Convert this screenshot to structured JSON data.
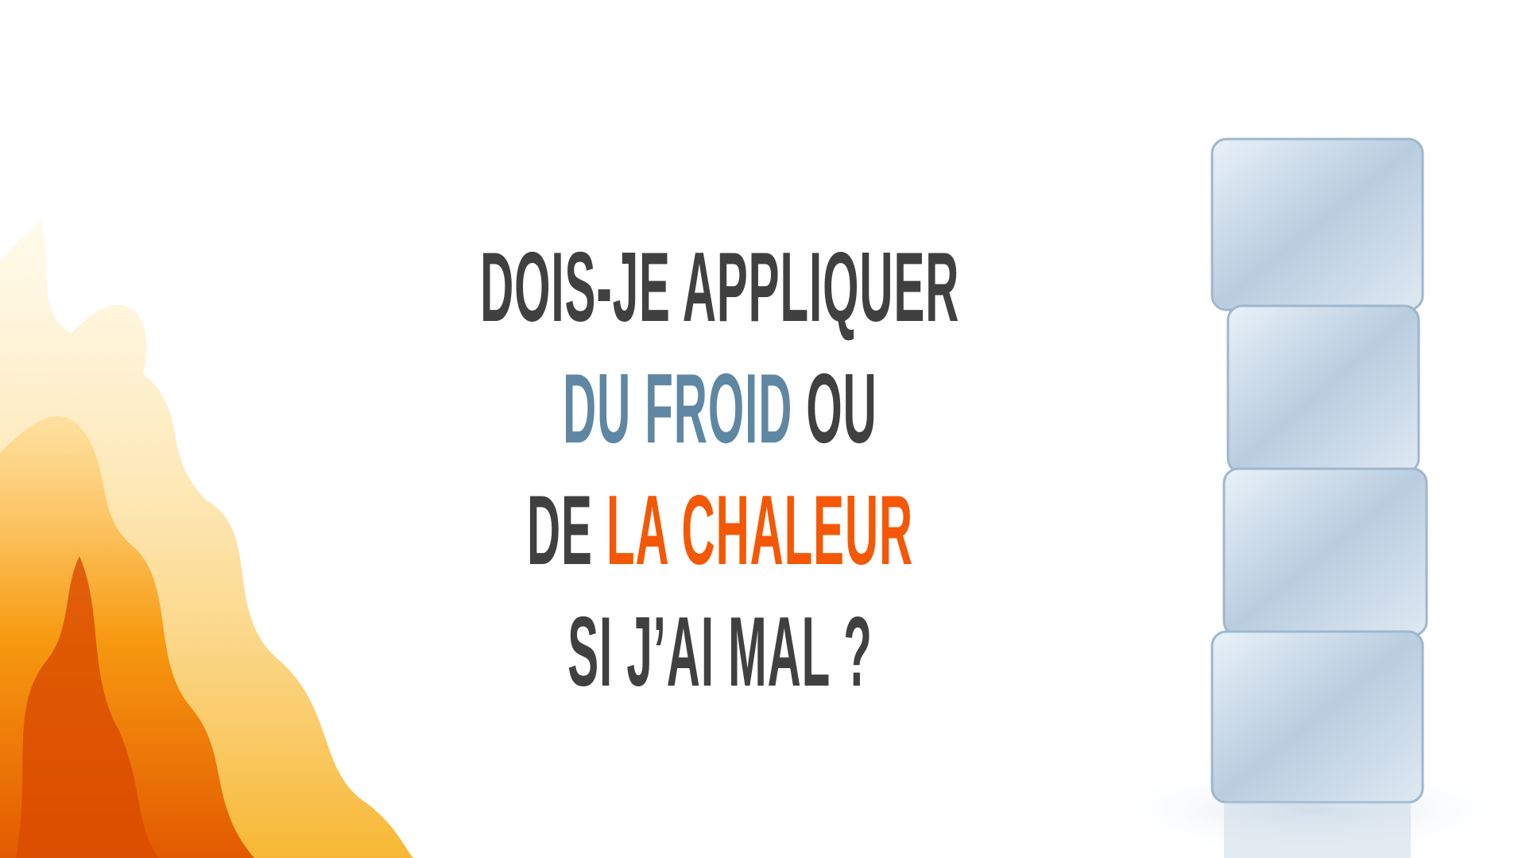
{
  "headline": {
    "line1": "DOIS-JE APPLIQUER",
    "line2_highlight": "DU FROID",
    "line2_rest": " OU",
    "line3_start": "DE ",
    "line3_highlight": "LA CHALEUR",
    "line4": "SI J’AI MAL ?"
  },
  "colors": {
    "text": "#404040",
    "cold": "#5f87a3",
    "heat": "#f55804"
  },
  "images": [
    "flame-image",
    "ice-cubes-image"
  ]
}
